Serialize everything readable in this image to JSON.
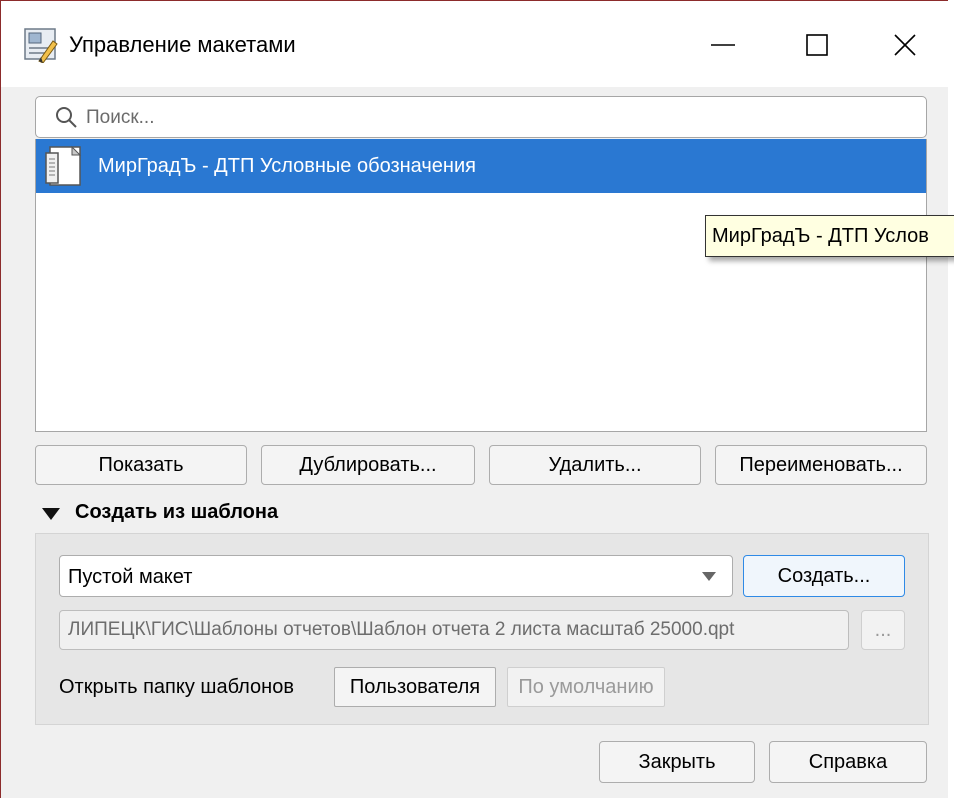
{
  "window": {
    "title": "Управление макетами",
    "icon": "layout-manager-icon",
    "controls": [
      "minimize-icon",
      "maximize-icon",
      "close-icon"
    ]
  },
  "search": {
    "placeholder": "Поиск...",
    "value": ""
  },
  "layouts": {
    "items": [
      {
        "label": "МирГрадЪ - ДТП Условные обозначения",
        "selected": true,
        "icon": "print-layout-icon"
      }
    ]
  },
  "tooltip": {
    "text": "МирГрадЪ - ДТП Услов"
  },
  "actions": {
    "show": "Показать",
    "duplicate": "Дублировать...",
    "delete": "Удалить...",
    "rename": "Переименовать..."
  },
  "template_section": {
    "title": "Создать из шаблона",
    "expanded": true,
    "template_select": {
      "selected": "Пустой макет"
    },
    "create_button": "Создать...",
    "path_value": "ЛИПЕЦК\\ГИС\\Шаблоны отчетов\\Шаблон отчета 2 листа масштаб 25000.qpt",
    "browse_button": "...",
    "open_folder_label": "Открыть папку шаблонов",
    "user_button": "Пользователя",
    "default_button": "По умолчанию"
  },
  "footer": {
    "close": "Закрыть",
    "help": "Справка"
  },
  "colors": {
    "selection": "#2a78d2",
    "tooltip_bg": "#ffffe1",
    "focus_border": "#2f8ae6",
    "dialog_bg": "#f0f0f0"
  }
}
